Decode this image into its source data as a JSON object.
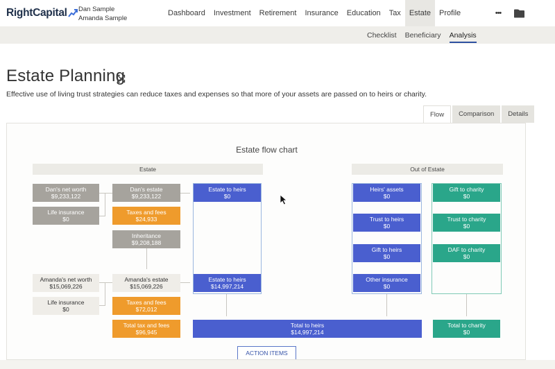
{
  "brand": {
    "name": "RightCapital"
  },
  "clients": {
    "primary": "Dan Sample",
    "secondary": "Amanda Sample"
  },
  "nav": {
    "items": [
      "Dashboard",
      "Investment",
      "Retirement",
      "Insurance",
      "Education",
      "Tax",
      "Estate",
      "Profile"
    ],
    "active": "Estate",
    "more_label": "•••"
  },
  "subnav": {
    "items": [
      "Checklist",
      "Beneficiary",
      "Analysis"
    ],
    "active": "Analysis"
  },
  "page": {
    "title": "Estate Planning",
    "subtitle": "Effective use of living trust strategies can reduce taxes and expenses so that more of your assets are passed on to heirs or charity."
  },
  "view_tabs": {
    "items": [
      "Flow",
      "Comparison",
      "Details"
    ],
    "active": "Flow"
  },
  "chart": {
    "title": "Estate flow chart",
    "band_estate": "Estate",
    "band_out": "Out of Estate",
    "dan_net_worth": {
      "label": "Dan's net worth",
      "value": "$9,233,122"
    },
    "dan_life_insurance": {
      "label": "Life insurance",
      "value": "$0"
    },
    "dan_estate": {
      "label": "Dan's estate",
      "value": "$9,233,122"
    },
    "dan_taxes": {
      "label": "Taxes and fees",
      "value": "$24,933"
    },
    "inheritance": {
      "label": "Inheritance",
      "value": "$9,208,188"
    },
    "amanda_net_worth": {
      "label": "Amanda's net worth",
      "value": "$15,069,226"
    },
    "amanda_life_insurance": {
      "label": "Life insurance",
      "value": "$0"
    },
    "amanda_estate": {
      "label": "Amanda's estate",
      "value": "$15,069,226"
    },
    "amanda_taxes": {
      "label": "Taxes and fees",
      "value": "$72,012"
    },
    "total_tax": {
      "label": "Total tax and fees",
      "value": "$96,945"
    },
    "estate_heirs_1": {
      "label": "Estate to heirs",
      "value": "$0"
    },
    "estate_heirs_2": {
      "label": "Estate to heirs",
      "value": "$14,997,214"
    },
    "total_heirs": {
      "label": "Total to heirs",
      "value": "$14,997,214"
    },
    "heirs_assets": {
      "label": "Heirs' assets",
      "value": "$0"
    },
    "trust_heirs": {
      "label": "Trust to heirs",
      "value": "$0"
    },
    "gift_heirs": {
      "label": "Gift to heirs",
      "value": "$0"
    },
    "other_insurance": {
      "label": "Other insurance",
      "value": "$0"
    },
    "gift_charity": {
      "label": "Gift to charity",
      "value": "$0"
    },
    "trust_charity": {
      "label": "Trust to charity",
      "value": "$0"
    },
    "daf_charity": {
      "label": "DAF to charity",
      "value": "$0"
    },
    "total_charity": {
      "label": "Total to charity",
      "value": "$0"
    },
    "action_button": "ACTION ITEMS"
  },
  "colors": {
    "nav_active_bg": "#e8e7e3",
    "tab_underline": "#2d50a0",
    "grey_box": "#a6a39d",
    "orange_box": "#ef9b2c",
    "blue_box": "#4a5fcf",
    "green_box": "#2aa68a"
  },
  "icons": {
    "more": "more-dots-icon",
    "folder": "folder-icon",
    "settings": "gear-icon",
    "expand": "expand-icon",
    "logo_mark": "chart-arrow-icon"
  }
}
